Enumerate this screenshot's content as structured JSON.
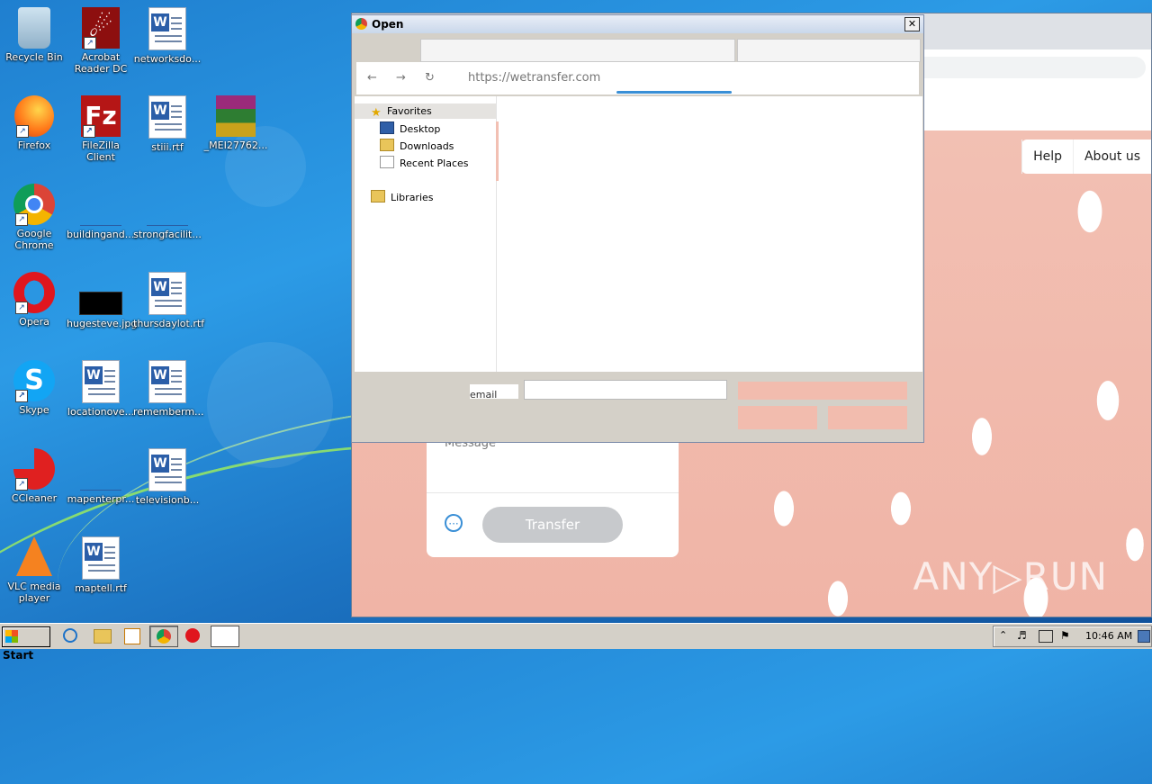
{
  "desktop": {
    "icons": [
      {
        "label": "Recycle Bin",
        "icon": "recycle-bin-icon"
      },
      {
        "label": "Acrobat Reader DC",
        "icon": "acrobat-icon"
      },
      {
        "label": "networksdo...",
        "icon": "word-doc-icon"
      },
      {
        "label": "Firefox",
        "icon": "firefox-icon"
      },
      {
        "label": "FileZilla Client",
        "icon": "filezilla-icon"
      },
      {
        "label": "stiii.rtf",
        "icon": "word-doc-icon"
      },
      {
        "label": "_MEI27762...",
        "icon": "winrar-icon"
      },
      {
        "label": "Google Chrome",
        "icon": "chrome-icon"
      },
      {
        "label": "buildingand....",
        "icon": "file-icon"
      },
      {
        "label": "strongfacilit...",
        "icon": "file-icon"
      },
      {
        "label": "Opera",
        "icon": "opera-icon"
      },
      {
        "label": "hugesteve.jpg",
        "icon": "image-file-icon"
      },
      {
        "label": "thursdaylot.rtf",
        "icon": "word-doc-icon"
      },
      {
        "label": "Skype",
        "icon": "skype-icon"
      },
      {
        "label": "locationove...",
        "icon": "word-doc-icon"
      },
      {
        "label": "rememberm...",
        "icon": "word-doc-icon"
      },
      {
        "label": "CCleaner",
        "icon": "ccleaner-icon"
      },
      {
        "label": "mapenterpr...",
        "icon": "file-icon"
      },
      {
        "label": "televisionb...",
        "icon": "word-doc-icon"
      },
      {
        "label": "VLC media player",
        "icon": "vlc-icon"
      },
      {
        "label": "maptell.rtf",
        "icon": "word-doc-icon"
      }
    ]
  },
  "browser": {
    "url": "https://wetransfer.com",
    "nav": {
      "help": "Help",
      "about": "About us"
    },
    "card": {
      "message_placeholder": "Message",
      "more_glyph": "···",
      "transfer": "Transfer"
    },
    "watermark": "ANY▷RUN"
  },
  "dialog": {
    "title": "Open",
    "close_glyph": "✕",
    "favorites": "Favorites",
    "nav_items": [
      "Desktop",
      "Downloads",
      "Recent Places"
    ],
    "libraries": "Libraries",
    "filename_label": "email"
  },
  "taskbar": {
    "start": "Start",
    "clock": "10:46 AM"
  },
  "colors": {
    "taskbar": "#d4d0c8",
    "site_pink": "#f0b4a6",
    "accent_blue": "#3a8fd6"
  }
}
